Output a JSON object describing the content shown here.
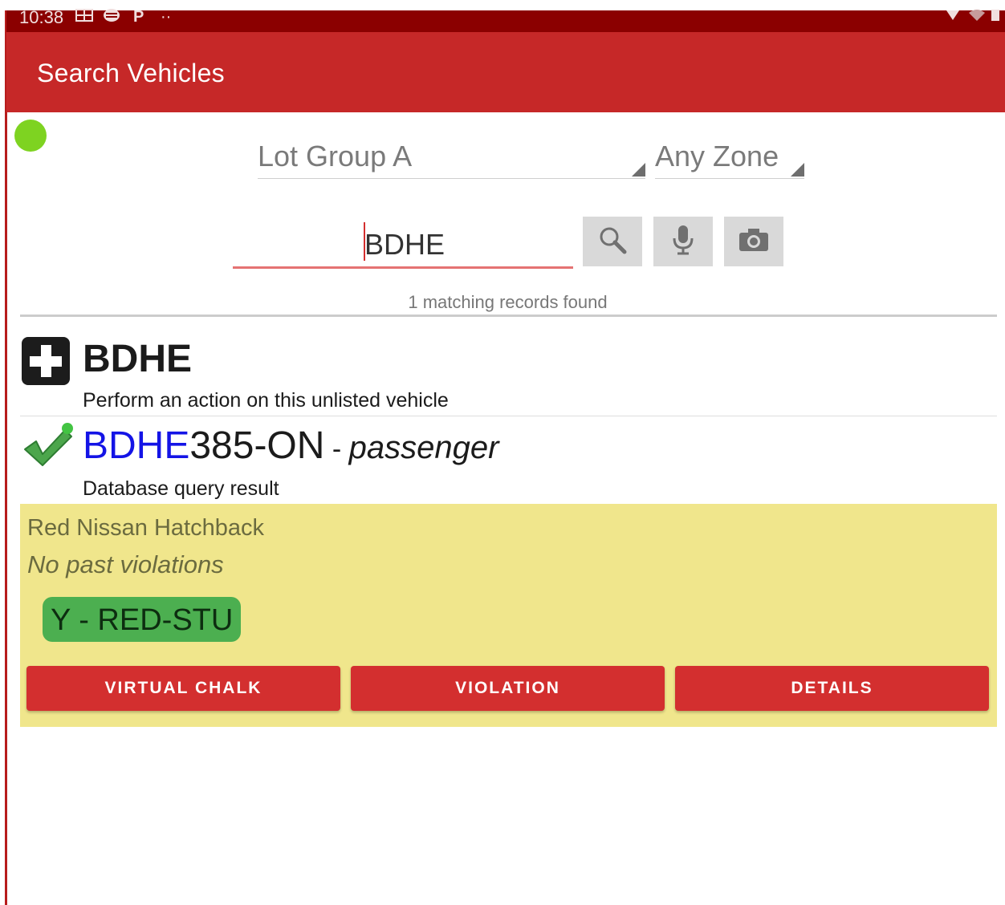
{
  "status_bar": {
    "time": "10:38",
    "icons": [
      "keyboard-icon",
      "mask-icon",
      "parking-icon",
      "more-icon",
      "signal-icon",
      "wifi-icon",
      "battery-icon"
    ],
    "parking_glyph": "P",
    "dots": "··"
  },
  "app_bar": {
    "title": "Search Vehicles",
    "color": "#c62828",
    "status_bar_color": "#8b0000"
  },
  "connection_status": {
    "color": "#7ed321"
  },
  "filters": {
    "lot_group": "Lot Group A",
    "zone": "Any Zone"
  },
  "search": {
    "query": "BDHE",
    "buttons": [
      "search-icon",
      "microphone-icon",
      "camera-icon"
    ],
    "result_count_text": "1 matching records found"
  },
  "results": {
    "unlisted": {
      "plate": "BDHE",
      "description": "Perform an action on this unlisted vehicle"
    },
    "match": {
      "plate_highlight": "BDHE",
      "plate_rest": "385-ON",
      "separator": " - ",
      "vehicle_type": "passenger",
      "source": "Database query result",
      "vehicle_description": "Red Nissan Hatchback",
      "violations": "No past violations",
      "permit": "Y - RED-STU",
      "highlight_color": "#f0e68c",
      "actions": {
        "virtual_chalk": "VIRTUAL CHALK",
        "violation": "VIOLATION",
        "details": "DETAILS"
      }
    }
  }
}
